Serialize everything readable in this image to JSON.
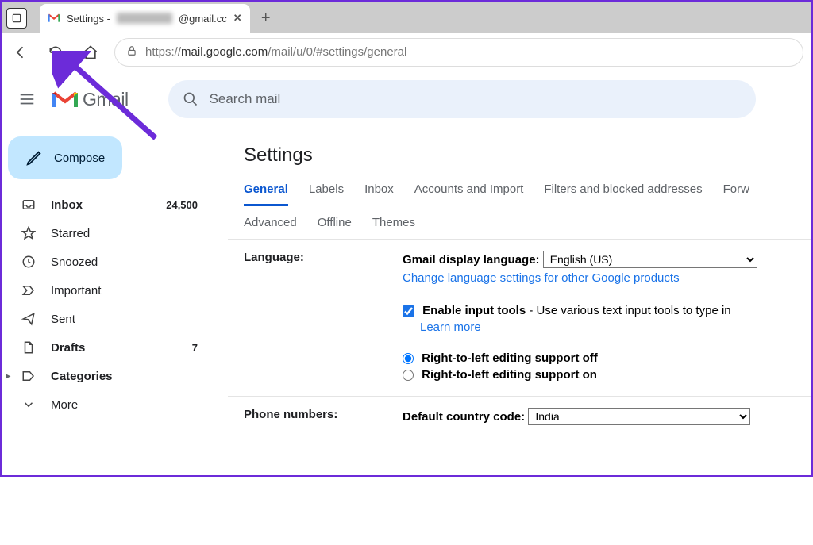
{
  "browser": {
    "tab_title_prefix": "Settings -",
    "tab_title_suffix": "@gmail.cc",
    "url_prefix": "https://",
    "url_domain": "mail.google.com",
    "url_path": "/mail/u/0/#settings/general"
  },
  "gmail": {
    "product_name": "Gmail",
    "search_placeholder": "Search mail",
    "compose_label": "Compose",
    "sidebar": [
      {
        "label": "Inbox",
        "count": "24,500",
        "bold": true,
        "icon": "inbox"
      },
      {
        "label": "Starred",
        "count": "",
        "bold": false,
        "icon": "star"
      },
      {
        "label": "Snoozed",
        "count": "",
        "bold": false,
        "icon": "clock"
      },
      {
        "label": "Important",
        "count": "",
        "bold": false,
        "icon": "important"
      },
      {
        "label": "Sent",
        "count": "",
        "bold": false,
        "icon": "sent"
      },
      {
        "label": "Drafts",
        "count": "7",
        "bold": true,
        "icon": "draft"
      },
      {
        "label": "Categories",
        "count": "",
        "bold": true,
        "icon": "category"
      },
      {
        "label": "More",
        "count": "",
        "bold": false,
        "icon": "more"
      }
    ]
  },
  "settings": {
    "title": "Settings",
    "tabs1": [
      "General",
      "Labels",
      "Inbox",
      "Accounts and Import",
      "Filters and blocked addresses",
      "Forw"
    ],
    "tabs2": [
      "Advanced",
      "Offline",
      "Themes"
    ],
    "active_tab": "General",
    "language": {
      "row_label": "Language:",
      "display_label": "Gmail display language:",
      "selected": "English (US)",
      "change_link": "Change language settings for other Google products",
      "enable_tools_label": "Enable input tools",
      "enable_tools_desc": " - Use various text input tools to type in",
      "learn_more": "Learn more",
      "rtl_off": "Right-to-left editing support off",
      "rtl_on": "Right-to-left editing support on"
    },
    "phone": {
      "row_label": "Phone numbers:",
      "default_label": "Default country code:",
      "selected": "India"
    }
  }
}
